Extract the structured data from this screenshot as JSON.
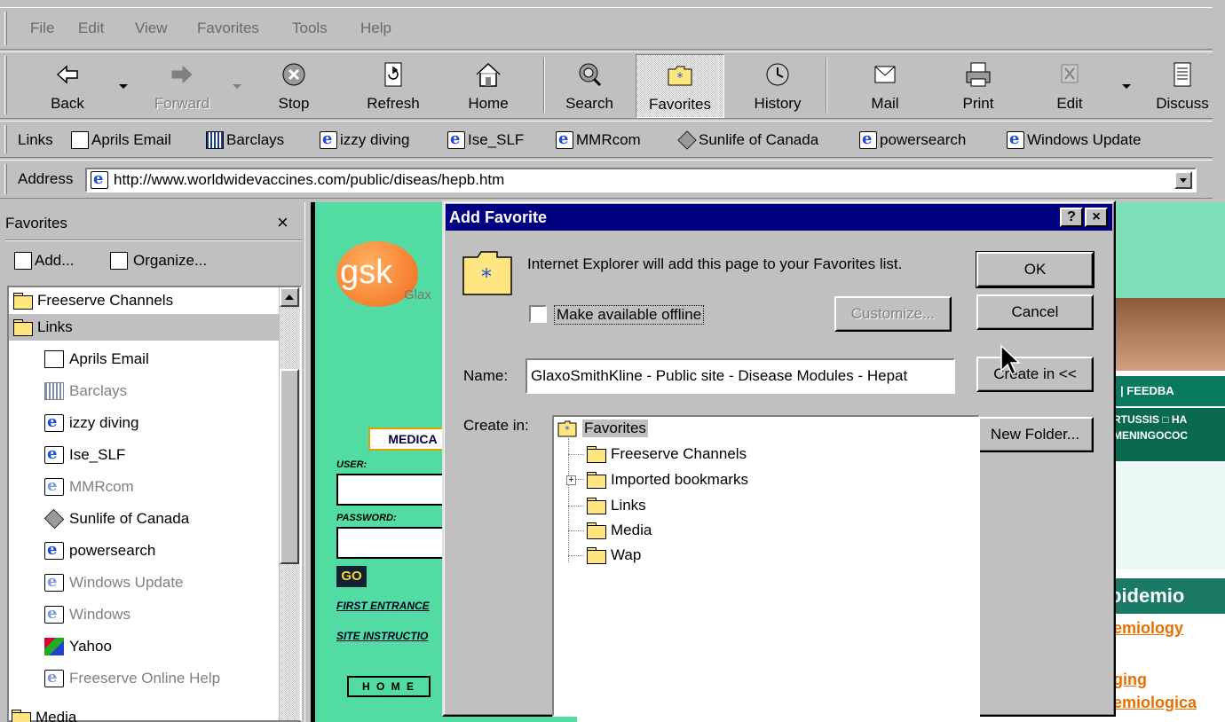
{
  "menu": [
    "File",
    "Edit",
    "View",
    "Favorites",
    "Tools",
    "Help"
  ],
  "toolbar": {
    "back": "Back",
    "forward": "Forward",
    "stop": "Stop",
    "refresh": "Refresh",
    "home": "Home",
    "search": "Search",
    "favorites": "Favorites",
    "history": "History",
    "mail": "Mail",
    "print": "Print",
    "edit": "Edit",
    "discuss": "Discuss"
  },
  "links_bar": {
    "label": "Links",
    "items": [
      "Aprils Email",
      "Barclays",
      "izzy diving",
      "Ise_SLF",
      "MMRcom",
      "Sunlife of Canada",
      "powersearch",
      "Windows Update"
    ]
  },
  "address": {
    "label": "Address",
    "url": "http://www.worldwidevaccines.com/public/diseas/hepb.htm"
  },
  "favorites_pane": {
    "title": "Favorites",
    "close": "×",
    "add": "Add...",
    "organize": "Organize...",
    "items": [
      "Freeserve Channels",
      "Links",
      "Aprils Email",
      "Barclays",
      "izzy diving",
      "Ise_SLF",
      "MMRcom",
      "Sunlife of Canada",
      "powersearch",
      "Windows Update",
      "Windows",
      "Yahoo",
      "Freeserve Online Help",
      "Media"
    ]
  },
  "web": {
    "brand": "gsk",
    "brand_partial": "Glax",
    "medical": "MEDICA",
    "user": "USER:",
    "password": "PASSWORD:",
    "go": "GO",
    "first_entrance": "FIRST ENTRANCE",
    "site_instructions": "SITE INSTRUCTIO",
    "home": "H O M E",
    "feedback": "| FEEDBA",
    "diseases_1": "RTUSSIS □ HA",
    "diseases_2": "MENINGOCOC",
    "epidem": "pidemio",
    "link1": "emiology",
    "link2": "ging",
    "link3": "emiologica"
  },
  "dialog": {
    "title": "Add Favorite",
    "help": "?",
    "close": "×",
    "message": "Internet Explorer will add this page to your Favorites list.",
    "offline_label": "Make available offline",
    "customize": "Customize...",
    "name_label": "Name:",
    "name_value": "GlaxoSmithKline - Public site - Disease Modules - Hepat",
    "create_in_label": "Create in:",
    "ok": "OK",
    "cancel": "Cancel",
    "create_in_button": "Create in <<",
    "new_folder": "New Folder...",
    "tree": [
      "Favorites",
      "Freeserve Channels",
      "Imported bookmarks",
      "Links",
      "Media",
      "Wap"
    ]
  }
}
